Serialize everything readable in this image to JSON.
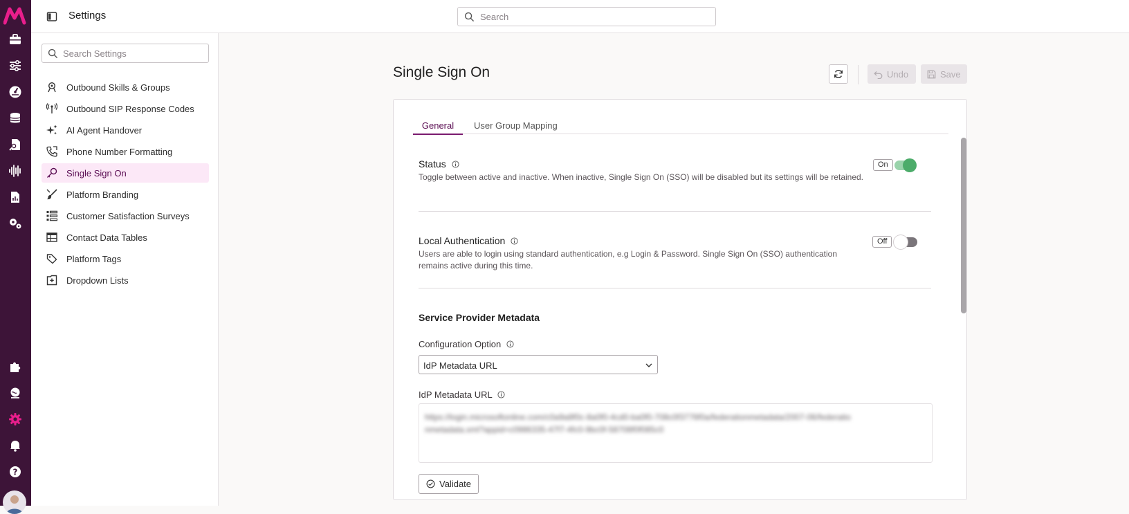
{
  "header": {
    "title": "Settings",
    "search_placeholder": "Search"
  },
  "sidebar": {
    "search_placeholder": "Search Settings",
    "items": [
      {
        "label": "Outbound Skills & Groups",
        "icon": "headset-icon"
      },
      {
        "label": "Outbound SIP Response Codes",
        "icon": "antenna-icon"
      },
      {
        "label": "AI Agent Handover",
        "icon": "sparkles-icon"
      },
      {
        "label": "Phone Number Formatting",
        "icon": "phone-icon"
      },
      {
        "label": "Single Sign On",
        "icon": "key-icon",
        "active": true
      },
      {
        "label": "Platform Branding",
        "icon": "brush-icon"
      },
      {
        "label": "Customer Satisfaction Surveys",
        "icon": "survey-icon"
      },
      {
        "label": "Contact Data Tables",
        "icon": "table-icon"
      },
      {
        "label": "Platform Tags",
        "icon": "tag-icon"
      },
      {
        "label": "Dropdown Lists",
        "icon": "list-box-icon"
      }
    ]
  },
  "main": {
    "title": "Single Sign On",
    "undo_label": "Undo",
    "save_label": "Save",
    "tabs": [
      {
        "label": "General",
        "active": true
      },
      {
        "label": "User Group Mapping"
      }
    ],
    "status": {
      "title": "Status",
      "description": "Toggle between active and inactive. When inactive, Single Sign On (SSO) will be disabled but its settings will be retained.",
      "pill": "On",
      "enabled": true
    },
    "local_auth": {
      "title": "Local Authentication",
      "description": "Users are able to login using standard authentication, e.g Login & Password. Single Sign On (SSO) authentication remains active during this time.",
      "pill": "Off",
      "enabled": false
    },
    "service_provider": {
      "title": "Service Provider Metadata",
      "config_label": "Configuration Option",
      "config_value": "IdP Metadata URL",
      "url_label": "IdP Metadata URL",
      "url_value": "https://login.microsoftonline.com/c0a9a8f0c-8a0f0-4cd0-ba0f0-708c0f3776f0a/federationmetadata/2007-06/federationmetadata.xml?appid=c0986335-47f7-4fc0-9bc0f-58708f0f085c0",
      "validate_label": "Validate"
    }
  },
  "colors": {
    "rail": "#3d1438",
    "brand": "#e91e8c",
    "active_bg": "#fce8f7",
    "toggle_on": "#4cac6a"
  }
}
